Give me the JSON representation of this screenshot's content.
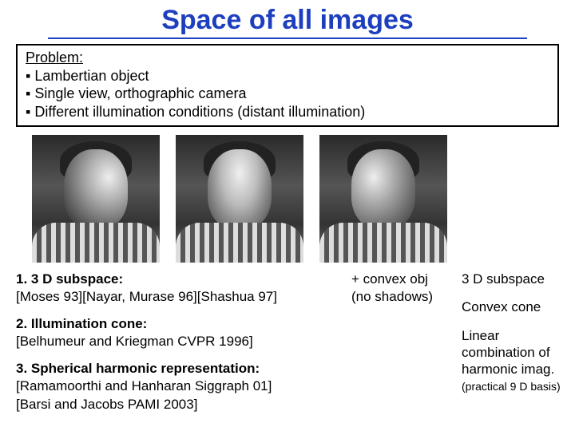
{
  "title": "Space of all images",
  "problem": {
    "heading": "Problem:",
    "bullets": [
      "Lambertian object",
      "Single view, orthographic camera",
      "Different illumination conditions  (distant illumination)"
    ]
  },
  "left": {
    "item1_title": "1. 3 D subspace:",
    "item1_refs": "[Moses 93][Nayar, Murase 96][Shashua 97]",
    "item2_title": "2. Illumination cone:",
    "item2_refs": "[Belhumeur and Kriegman CVPR 1996]",
    "item3_title": "3. Spherical harmonic representation:",
    "item3_refs1": "[Ramamoorthi and Hanharan Siggraph 01]",
    "item3_refs2": "[Barsi and Jacobs PAMI 2003]"
  },
  "mid": {
    "line1": "+ convex obj",
    "line2": "(no shadows)"
  },
  "right": {
    "r1": "3 D subspace",
    "r2": "Convex cone",
    "r3a": "Linear combination of harmonic imag.",
    "r3b": "(practical 9 D basis)"
  }
}
